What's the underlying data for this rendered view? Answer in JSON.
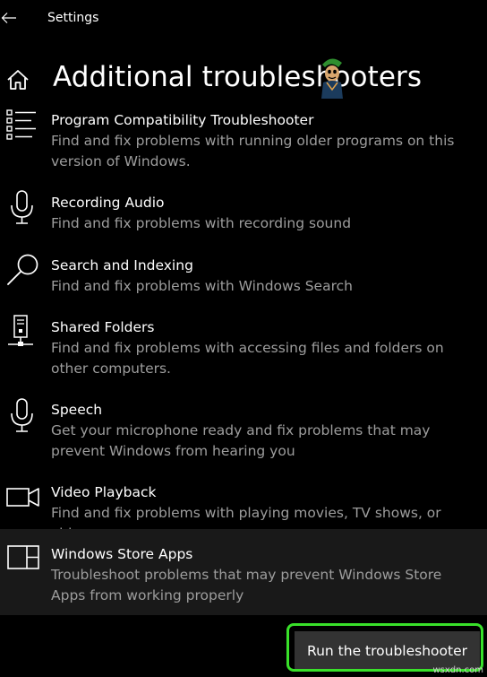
{
  "window": {
    "title": "Settings"
  },
  "page": {
    "title": "Additional troubleshooters"
  },
  "troubleshooters": [
    {
      "name": "Program Compatibility Troubleshooter",
      "description": "Find and fix problems with running older programs on this version of Windows.",
      "icon": "list-icon"
    },
    {
      "name": "Recording Audio",
      "description": "Find and fix problems with recording sound",
      "icon": "microphone-icon"
    },
    {
      "name": "Search and Indexing",
      "description": "Find and fix problems with Windows Search",
      "icon": "search-icon"
    },
    {
      "name": "Shared Folders",
      "description": "Find and fix problems with accessing files and folders on other computers.",
      "icon": "network-drive-icon"
    },
    {
      "name": "Speech",
      "description": "Get your microphone ready and fix problems that may prevent Windows from hearing you",
      "icon": "microphone-icon"
    },
    {
      "name": "Video Playback",
      "description": "Find and fix problems with playing movies, TV shows, or videos",
      "icon": "video-camera-icon"
    },
    {
      "name": "Windows Store Apps",
      "description": "Troubleshoot problems that may prevent Windows Store Apps from working properly",
      "icon": "store-apps-icon",
      "selected": true
    }
  ],
  "actions": {
    "run_label": "Run the troubleshooter"
  },
  "watermark": "wsxdn.com",
  "colors": {
    "background": "#000000",
    "selected_row": "#191919",
    "button": "#333333",
    "secondary_text": "#9d9d9d",
    "highlight": "#39e12a"
  }
}
